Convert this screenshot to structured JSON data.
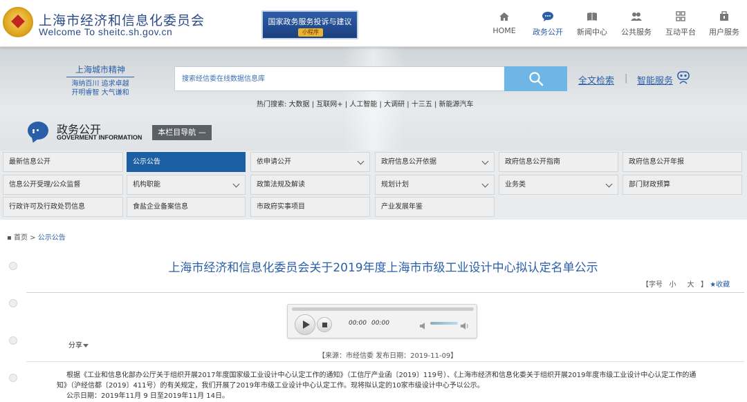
{
  "header": {
    "site_name_cn": "上海市经济和信息化委员会",
    "site_name_en": "Welcome To sheitc.sh.gov.cn",
    "gov_banner_title": "国家政务服务投诉与建议",
    "gov_banner_sub": "小程序",
    "nav": [
      {
        "label": "HOME",
        "icon": "home-icon"
      },
      {
        "label": "政务公开",
        "icon": "chat-bubble-icon",
        "active": true
      },
      {
        "label": "新闻中心",
        "icon": "news-icon"
      },
      {
        "label": "公共服务",
        "icon": "people-icon"
      },
      {
        "label": "互动平台",
        "icon": "grid-icon"
      },
      {
        "label": "用户服务",
        "icon": "briefcase-icon"
      }
    ]
  },
  "hero": {
    "spirit_title": "上海城市精神",
    "spirit_line1": "海纳百川 追求卓越",
    "spirit_line2": "开明睿智 大气谦和",
    "search_placeholder": "搜索经信委在线数据信息库",
    "fulltext_label": "全文检索",
    "separator": "|",
    "smart_label": "智能服务",
    "hot_search": "热门搜索: 大数据 | 互联网+ | 人工智能 | 大调研 | 十三五 | 新能源汽车",
    "section_cn": "政务公开",
    "section_en": "GOVERMENT INFORMATION",
    "column_nav_label": "本栏目导航 —"
  },
  "grid": {
    "cells": [
      {
        "label": "最新信息公开",
        "chevron": false,
        "active": false
      },
      {
        "label": "公示公告",
        "chevron": false,
        "active": true
      },
      {
        "label": "依申请公开",
        "chevron": true,
        "active": false
      },
      {
        "label": "政府信息公开依据",
        "chevron": true,
        "active": false
      },
      {
        "label": "政府信息公开指南",
        "chevron": false,
        "active": false
      },
      {
        "label": "政府信息公开年报",
        "chevron": false,
        "active": false
      },
      {
        "label": "信息公开受理/公众监督",
        "chevron": false,
        "active": false
      },
      {
        "label": "机构职能",
        "chevron": true,
        "active": false
      },
      {
        "label": "政策法规及解读",
        "chevron": false,
        "active": false
      },
      {
        "label": "规划计划",
        "chevron": true,
        "active": false
      },
      {
        "label": "业务类",
        "chevron": true,
        "active": false
      },
      {
        "label": "部门财政预算",
        "chevron": false,
        "active": false
      },
      {
        "label": "行政许可及行政处罚信息",
        "chevron": false,
        "active": false
      },
      {
        "label": "食盐企业备案信息",
        "chevron": false,
        "active": false
      },
      {
        "label": "市政府实事项目",
        "chevron": false,
        "active": false
      },
      {
        "label": "产业发展年鉴",
        "chevron": false,
        "active": false
      }
    ]
  },
  "breadcrumb": {
    "home": "首页",
    "sep": ">",
    "current": "公示公告"
  },
  "article": {
    "title": "上海市经济和信息化委员会关于2019年度上海市市级工业设计中心拟认定名单公示",
    "fontsize_open": "【字号",
    "fontsize_small": "小",
    "fontsize_large": "大",
    "fontsize_close": "】",
    "favorite": "★收藏",
    "player_time_current": "00:00",
    "player_time_total": "00:00",
    "share_label": "分享",
    "source": "【来源：市经信委 发布日期：2019-11-09】",
    "para1": "根据《工业和信息化部办公厅关于组织开展2017年度国家级工业设计中心认定工作的通知》（工信厅产业函〔2019〕119号）、《上海市经济和信息化委关于组织开展2019年度市级工业设计中心认定工作的通",
    "para2": "知》（沪经信都〔2019〕411号）的有关规定，我们开展了2019年市级工业设计中心认定工作。现将拟认定的10家市级设计中心予以公示。",
    "para3": "公示日期：2019年11月 9 日至2019年11月 14日。"
  },
  "colors": {
    "brand_blue": "#2a5ea8",
    "active_cell": "#1d5fa3",
    "search_button": "#6fb5e6"
  }
}
